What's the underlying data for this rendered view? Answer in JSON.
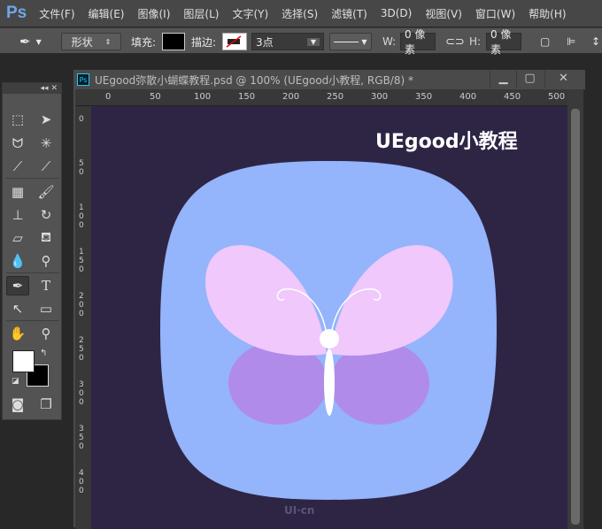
{
  "app": {
    "logo": "Ps"
  },
  "menu": [
    "文件(F)",
    "编辑(E)",
    "图像(I)",
    "图层(L)",
    "文字(Y)",
    "选择(S)",
    "滤镜(T)",
    "3D(D)",
    "视图(V)",
    "窗口(W)",
    "帮助(H)"
  ],
  "options": {
    "mode": "形状",
    "fill_label": "填充:",
    "stroke_label": "描边:",
    "stroke_width": "3点",
    "w_label": "W:",
    "w_value": "0 像素",
    "h_label": "H:",
    "h_value": "0 像素"
  },
  "toolbox": {
    "collapse": "◂◂",
    "close": "✕"
  },
  "document": {
    "title": "UEgood弥散小蝴蝶教程.psd @ 100% (UEgood小教程, RGB/8) *",
    "minimize": "▁",
    "maximize": "▢",
    "close": "✕",
    "h_ruler": [
      "0",
      "50",
      "100",
      "150",
      "200",
      "250",
      "300",
      "350",
      "400",
      "450",
      "500"
    ],
    "v_ruler": [
      "0",
      "50",
      "100",
      "150",
      "200",
      "250",
      "300",
      "350",
      "400"
    ],
    "canvas_title": "UEgood小教程",
    "watermark": "UI·cn"
  },
  "colors": {
    "canvas_bg": "#2e2545",
    "icon_bg": "#94b4fb",
    "wing_upper": "#f0c8fc",
    "wing_lower": "#b08ce8",
    "body": "#ffffff"
  }
}
